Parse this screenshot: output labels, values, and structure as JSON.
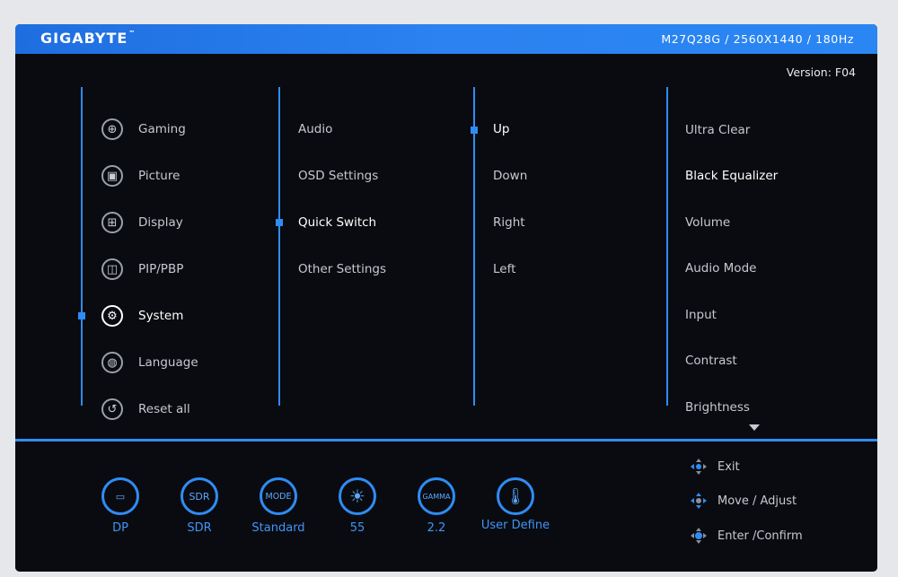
{
  "header": {
    "brand": "GIGABYTE",
    "spec": "M27Q28G / 2560X1440 / 180Hz",
    "version": "Version: F04"
  },
  "main_menu": [
    {
      "label": "Gaming",
      "icon": "gamepad-icon",
      "selected": false
    },
    {
      "label": "Picture",
      "icon": "picture-icon",
      "selected": false
    },
    {
      "label": "Display",
      "icon": "display-grid-icon",
      "selected": false
    },
    {
      "label": "PIP/PBP",
      "icon": "pip-icon",
      "selected": false
    },
    {
      "label": "System",
      "icon": "system-icon",
      "selected": true
    },
    {
      "label": "Language",
      "icon": "globe-icon",
      "selected": false
    },
    {
      "label": "Reset all",
      "icon": "reset-icon",
      "selected": false
    }
  ],
  "system_menu": [
    {
      "label": "Audio",
      "selected": false
    },
    {
      "label": "OSD Settings",
      "selected": false
    },
    {
      "label": "Quick Switch",
      "selected": true
    },
    {
      "label": "Other Settings",
      "selected": false
    }
  ],
  "quick_switch_menu": [
    {
      "label": "Up",
      "selected": true
    },
    {
      "label": "Down",
      "selected": false
    },
    {
      "label": "Right",
      "selected": false
    },
    {
      "label": "Left",
      "selected": false
    }
  ],
  "assign_menu": [
    {
      "label": "Ultra Clear",
      "selected": false
    },
    {
      "label": "Black Equalizer",
      "selected": true
    },
    {
      "label": "Volume",
      "selected": false
    },
    {
      "label": "Audio Mode",
      "selected": false
    },
    {
      "label": "Input",
      "selected": false
    },
    {
      "label": "Contrast",
      "selected": false
    },
    {
      "label": "Brightness",
      "selected": false
    }
  ],
  "status_bar": [
    {
      "icon": "displayport-icon",
      "icon_text": "",
      "value": "DP"
    },
    {
      "icon": "sdr-icon",
      "icon_text": "SDR",
      "value": "SDR"
    },
    {
      "icon": "mode-icon",
      "icon_text": "MODE",
      "value": "Standard"
    },
    {
      "icon": "brightness-icon",
      "icon_text": "☀",
      "value": "55"
    },
    {
      "icon": "gamma-icon",
      "icon_text": "GAMMA",
      "value": "2.2"
    },
    {
      "icon": "thermometer-icon",
      "icon_text": "🌡",
      "value": "User Define"
    }
  ],
  "hints": [
    {
      "label": "Exit",
      "icon": "joystick-left-icon"
    },
    {
      "label": "Move / Adjust",
      "icon": "joystick-move-icon"
    },
    {
      "label": "Enter /Confirm",
      "icon": "joystick-press-icon"
    }
  ],
  "colors": {
    "accent": "#2f8cf4",
    "header": "#2a86f3",
    "background": "#0a0b10",
    "text": "#c6c9d0"
  }
}
